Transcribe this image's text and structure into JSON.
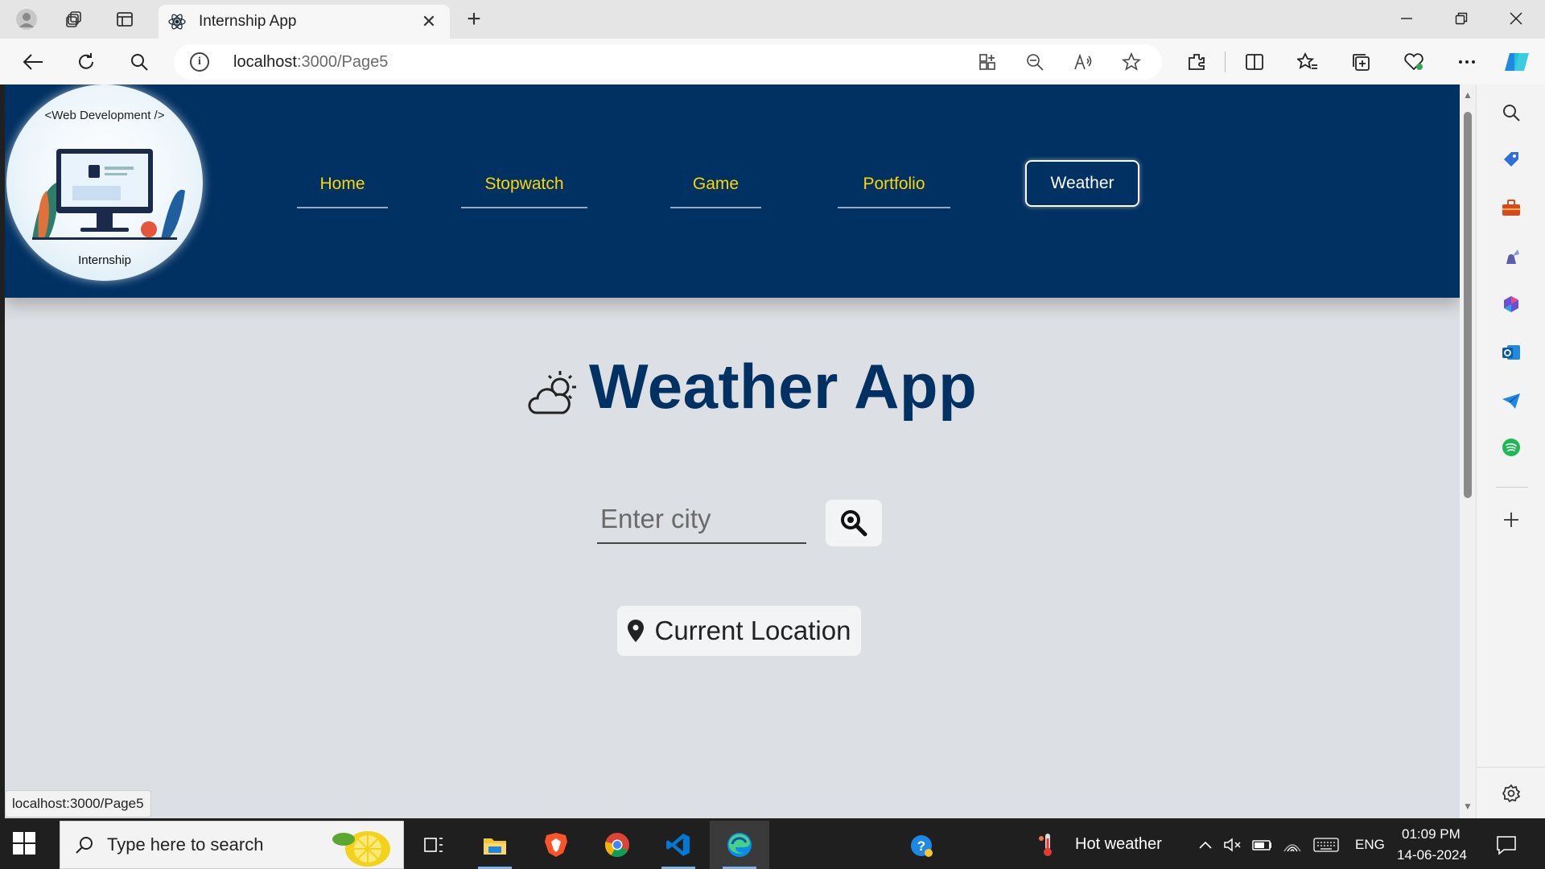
{
  "browser": {
    "tab_title": "Internship App",
    "url_host": "localhost",
    "url_path": ":3000/Page5",
    "status_url": "localhost:3000/Page5"
  },
  "site": {
    "logo": {
      "top_text": "<Web Development />",
      "bottom_text": "Internship"
    },
    "nav": [
      {
        "label": "Home",
        "active": false
      },
      {
        "label": "Stopwatch",
        "active": false
      },
      {
        "label": "Game",
        "active": false
      },
      {
        "label": "Portfolio",
        "active": false
      },
      {
        "label": "Weather",
        "active": true
      }
    ],
    "colors": {
      "header_bg": "#003163",
      "nav_link": "#ffd500",
      "page_bg": "#dcdfe3",
      "title": "#003163"
    }
  },
  "weather": {
    "title": "Weather App",
    "title_icon": "cloud-sun-icon",
    "city_placeholder": "Enter city",
    "search_icon": "magnifier-icon",
    "current_location_label": "Current Location",
    "location_icon": "map-pin-icon"
  },
  "taskbar": {
    "search_placeholder": "Type here to search",
    "weather_text": "Hot weather",
    "language": "ENG",
    "time": "01:09 PM",
    "date": "14-06-2024"
  }
}
